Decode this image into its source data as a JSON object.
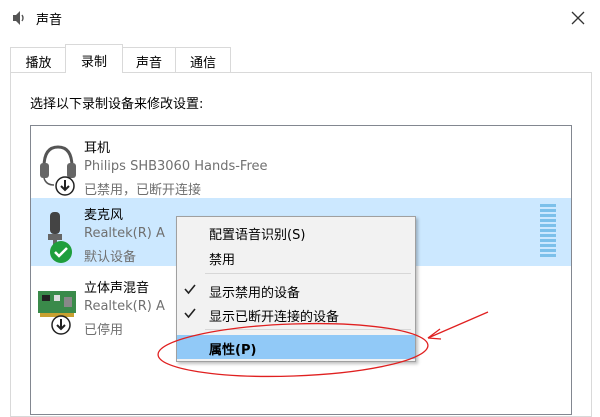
{
  "window": {
    "title": "声音",
    "icon": "speaker-icon",
    "close_icon": "close-icon"
  },
  "tabs": [
    {
      "label": "播放",
      "active": false
    },
    {
      "label": "录制",
      "active": true
    },
    {
      "label": "声音",
      "active": false
    },
    {
      "label": "通信",
      "active": false
    }
  ],
  "instruction": "选择以下录制设备来修改设置:",
  "devices": [
    {
      "name": "耳机",
      "line1": "Philips SHB3060 Hands-Free",
      "line2": "已禁用，已断开连接",
      "icon": "headset-icon",
      "status_icon": "down-arrow-badge-icon",
      "selected": false
    },
    {
      "name": "麦克风",
      "line1": "Realtek(R) A",
      "line2": "默认设备",
      "icon": "microphone-icon",
      "status_icon": "green-check-badge-icon",
      "selected": true
    },
    {
      "name": "立体声混音",
      "line1": "Realtek(R) A",
      "line2": "已停用",
      "icon": "sound-card-icon",
      "status_icon": "down-arrow-badge-icon",
      "selected": false
    }
  ],
  "context_menu": {
    "items": [
      {
        "label": "配置语音识别(S)",
        "checked": false,
        "highlighted": false
      },
      {
        "label": "禁用",
        "checked": false,
        "highlighted": false
      },
      {
        "label": "显示禁用的设备",
        "checked": true,
        "highlighted": false
      },
      {
        "label": "显示已断开连接的设备",
        "checked": true,
        "highlighted": false
      },
      {
        "label": "属性(P)",
        "checked": false,
        "highlighted": true
      }
    ]
  },
  "annotation": {
    "color": "#e02020"
  },
  "colors": {
    "selection": "#cce8ff",
    "menu_highlight": "#91c9f7",
    "check_green": "#1e9e3c"
  }
}
